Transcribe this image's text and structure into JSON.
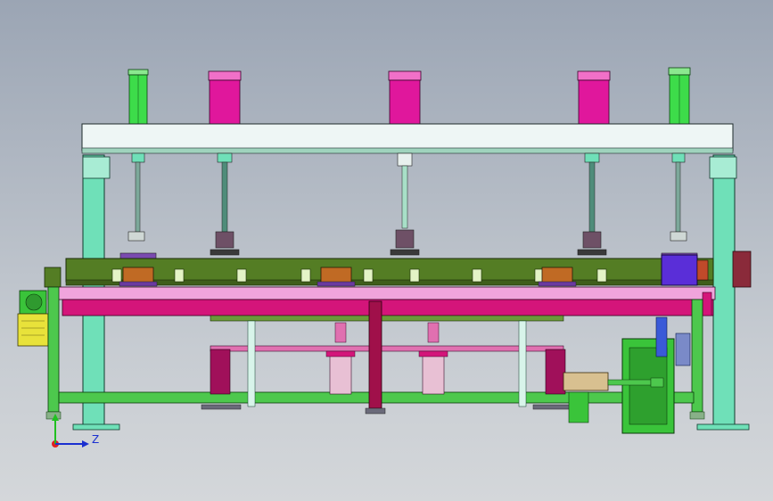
{
  "axes": {
    "horizontal_label": "Z"
  },
  "colors": {
    "top_beam": "#e9f3f1",
    "columns": "#6fe0b8",
    "cylinder_pink": "#e0179c",
    "cylinder_green": "#3ddc4a",
    "conveyor": "#547d24",
    "magenta_rail": "#d4157a",
    "lower_frame": "#4dc84d",
    "gearbox": "#3ac43a",
    "motor_yellow": "#e8e23a",
    "drive_blue": "#5a2ed8"
  },
  "icons": {
    "triad": "axis-triad-icon"
  }
}
